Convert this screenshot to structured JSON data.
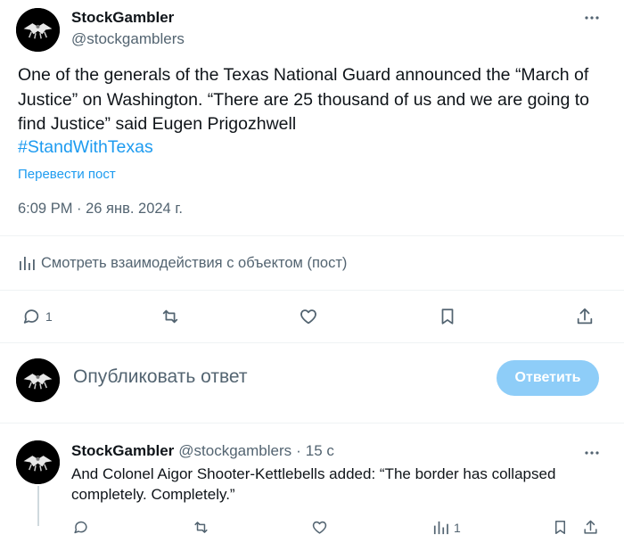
{
  "main_post": {
    "author_name": "StockGambler",
    "author_handle": "@stockgamblers",
    "text": "One of the generals of the Texas National Guard announced the “March of Justice” on Washington. “There are 25 thousand of us and we are going to find Justice” said Eugen Prigozhwell",
    "hashtag": "#StandWithTexas",
    "translate_label": "Перевести пост",
    "timestamp": "6:09 PM · 26 янв. 2024 г.",
    "analytics_label": "Смотреть взаимодействия с объектом (пост)",
    "actions": {
      "reply_count": "1",
      "reply_icon": "reply-icon",
      "repost_icon": "repost-icon",
      "like_icon": "heart-icon",
      "bookmark_icon": "bookmark-icon",
      "share_icon": "share-icon"
    }
  },
  "compose": {
    "placeholder": "Опубликовать ответ",
    "submit_label": "Ответить",
    "submit_color": "#8ecdf8"
  },
  "reply_post": {
    "author_name": "StockGambler",
    "author_handle": "@stockgamblers",
    "separator": "·",
    "time": "15 с",
    "text": "And Colonel Aigor Shooter-Kettlebells added: “The border has collapsed completely. Completely.”",
    "views_count": "1"
  },
  "colors": {
    "link": "#1d9bf0",
    "secondary_text": "#536471",
    "primary_text": "#0f1419"
  }
}
